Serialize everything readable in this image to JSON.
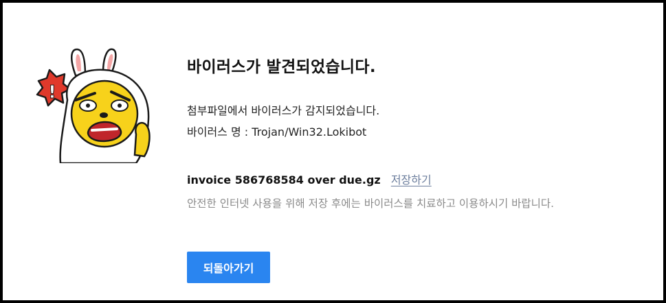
{
  "page": {
    "title": "바이러스가 발견되었습니다.",
    "description_line1": "첨부파일에서 바이러스가 감지되었습니다.",
    "description_line2": "바이러스 명 : Trojan/Win32.Lokibot",
    "file_name": "invoice 586768584 over due.gz",
    "save_link": "저장하기",
    "hint": "안전한 인터넷 사용을 위해 저장 후에는 바이러스를 치료하고 이용하시기 바랍니다.",
    "back_button": "되돌아가기"
  },
  "mascot": {
    "icon": "shocked-bunny-hood-mascot",
    "alert_symbol": "!"
  },
  "colors": {
    "button": "#2a85f0",
    "link": "#6b7d9c",
    "hint": "#8a8a8a",
    "alert": "#e0392b",
    "mascot_face": "#f7d21b"
  }
}
